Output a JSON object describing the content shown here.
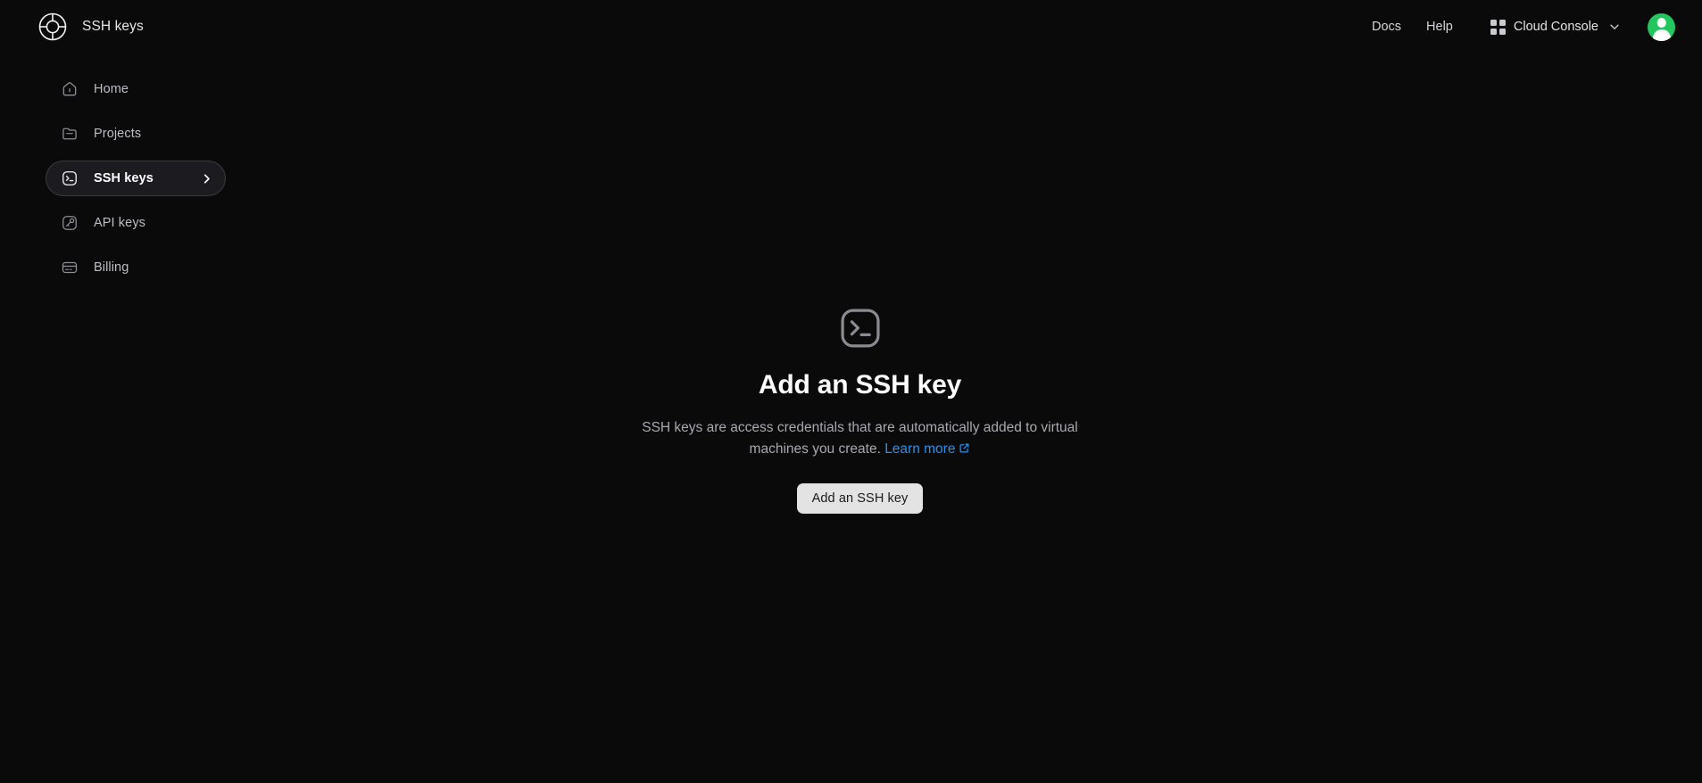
{
  "header": {
    "brand_title": "SSH keys",
    "logo_icon": "concentric-circle-logo",
    "docs_label": "Docs",
    "help_label": "Help",
    "grid_icon": "grid-apps-icon",
    "console_label": "Cloud Console",
    "chevron_icon": "chevron-down-icon",
    "avatar_icon": "user-avatar",
    "avatar_color": "#23c55e"
  },
  "sidebar": {
    "items": [
      {
        "label": "Home",
        "icon": "home-icon",
        "active": false
      },
      {
        "label": "Projects",
        "icon": "folder-icon",
        "active": false
      },
      {
        "label": "SSH keys",
        "icon": "terminal-icon",
        "active": true
      },
      {
        "label": "API keys",
        "icon": "key-icon",
        "active": false
      },
      {
        "label": "Billing",
        "icon": "credit-card-icon",
        "active": false
      }
    ]
  },
  "main": {
    "empty_state": {
      "icon": "terminal-icon",
      "title": "Add an SSH key",
      "description": "SSH keys are access credentials that are automatically added to virtual machines you create.",
      "learn_more_label": "Learn more",
      "learn_more_icon": "external-link-icon",
      "learn_more_color": "#2b8fe8",
      "button_label": "Add an SSH key"
    }
  },
  "colors": {
    "background": "#0a0a0b",
    "active_item_bg": "#1c1c20",
    "button_bg": "#e3e3e4"
  }
}
